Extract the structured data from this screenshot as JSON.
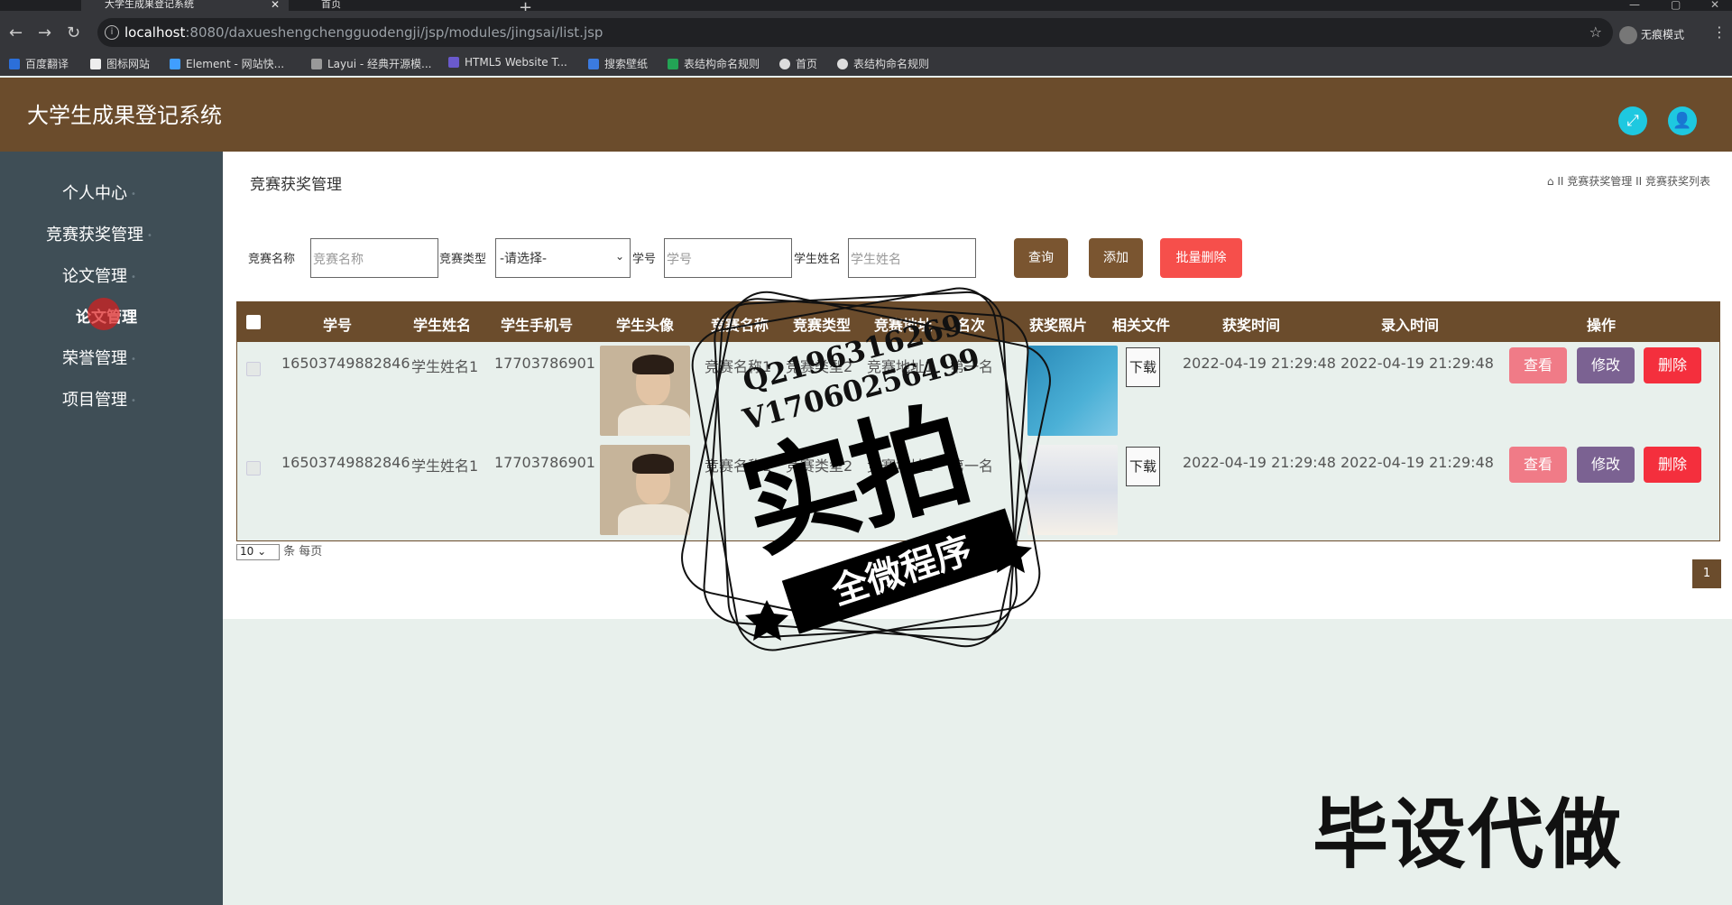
{
  "browser": {
    "tab_active": "大学生成果登记系统",
    "tab_second": "首页",
    "url_host": "localhost",
    "url_path": ":8080/daxueshengchengguodengji/jsp/modules/jingsai/list.jsp",
    "incognito_label": "无痕模式",
    "bookmarks": [
      "百度翻译",
      "图标网站",
      "Element - 网站快...",
      "Layui - 经典开源模...",
      "HTML5 Website T...",
      "搜索壁纸",
      "表结构命名规则",
      "首页",
      "表结构命名规则"
    ]
  },
  "app": {
    "title": "大学生成果登记系统",
    "colors": {
      "header": "#6b4c2c",
      "sidebar": "#3f4e56",
      "accent": "#1ec8e0"
    }
  },
  "sidebar": {
    "items": [
      "个人中心",
      "竞赛获奖管理",
      "论文管理",
      "论文管理",
      "荣誉管理",
      "项目管理"
    ]
  },
  "main": {
    "page_title": "竞赛获奖管理",
    "breadcrumb": {
      "sep": "II",
      "level1": "竞赛获奖管理",
      "level2": "竞赛获奖列表"
    },
    "filters": {
      "name_label": "竞赛名称",
      "name_placeholder": "竞赛名称",
      "type_label": "竞赛类型",
      "type_value": "-请选择-",
      "id_label": "学号",
      "id_placeholder": "学号",
      "student_label": "学生姓名",
      "student_placeholder": "学生姓名"
    },
    "buttons": {
      "query": "查询",
      "add": "添加",
      "batch_delete": "批量删除"
    },
    "table": {
      "headers": [
        "学号",
        "学生姓名",
        "学生手机号",
        "学生头像",
        "竞赛名称",
        "竞赛类型",
        "竞赛地址",
        "名次",
        "获奖照片",
        "相关文件",
        "获奖时间",
        "录入时间",
        "操作"
      ],
      "rows": [
        {
          "student_no": "16503749882846",
          "student_name": "学生姓名1",
          "phone": "17703786901",
          "comp_name": "竞赛名称1",
          "comp_type": "竞赛类型2",
          "comp_addr": "竞赛地址1",
          "rank": "第一名",
          "download": "下载",
          "award_time": "2022-04-19 21:29:48",
          "entry_time": "2022-04-19 21:29:48"
        },
        {
          "student_no": "16503749882846",
          "student_name": "学生姓名1",
          "phone": "17703786901",
          "comp_name": "竞赛名称1",
          "comp_type": "竞赛类型2",
          "comp_addr": "竞赛地址1",
          "rank": "第一名",
          "download": "下载",
          "award_time": "2022-04-19 21:29:48",
          "entry_time": "2022-04-19 21:29:48"
        }
      ],
      "actions": {
        "view": "查看",
        "edit": "修改",
        "delete": "删除"
      }
    },
    "pager": {
      "page_size": "10",
      "per_page_label": "条 每页",
      "current_page": "1"
    }
  },
  "watermark": {
    "qq": "Q2196316269",
    "vx": "V17060256499",
    "big": "实拍",
    "ribbon": "全微程序",
    "corner": "毕设代做"
  }
}
